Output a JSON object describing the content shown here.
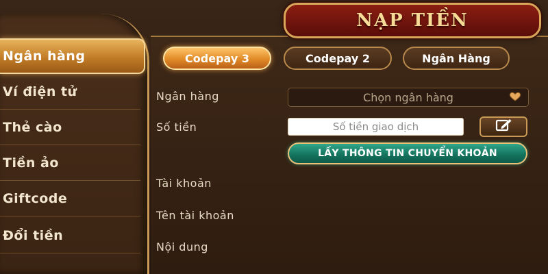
{
  "title": "NẠP TIỀN",
  "sidebar": {
    "items": [
      {
        "label": "Ngân hàng"
      },
      {
        "label": "Ví điện tử"
      },
      {
        "label": "Thẻ cào"
      },
      {
        "label": "Tiền ảo"
      },
      {
        "label": "Giftcode"
      },
      {
        "label": "Đổi tiền"
      }
    ],
    "active_index": 0
  },
  "tabs": [
    {
      "label": "Codepay 3",
      "active": true
    },
    {
      "label": "Codepay 2",
      "active": false
    },
    {
      "label": "Ngân Hàng",
      "active": false
    }
  ],
  "form": {
    "bank_label": "Ngân hàng",
    "bank_select_value": "Chọn ngân hàng",
    "amount_label": "Số tiền",
    "amount_placeholder": "Số tiền giao dịch",
    "action_button": "LẤY THÔNG TIN CHUYỂN KHOẢN",
    "account_label": "Tài khoản",
    "account_name_label": "Tên tài khoản",
    "content_label": "Nội dung"
  },
  "icons": {
    "select_dropdown": "heart-dropdown-icon",
    "edit": "edit-icon"
  },
  "colors": {
    "accent_gold": "#d9a75a",
    "title_red": "#8a1e12",
    "action_green": "#13725c"
  }
}
